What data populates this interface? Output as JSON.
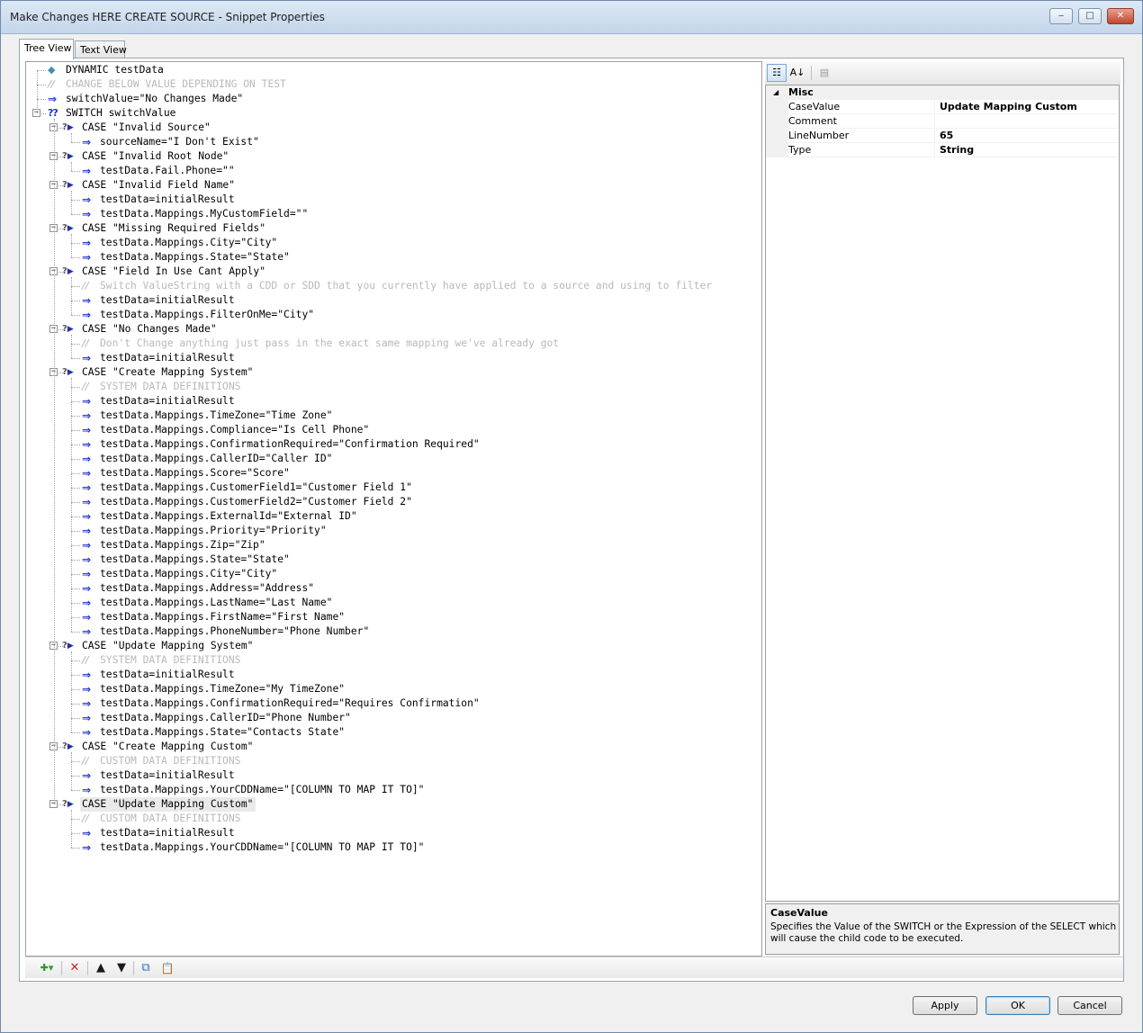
{
  "window": {
    "title": "Make Changes HERE CREATE SOURCE - Snippet Properties",
    "controls": {
      "minimize": "‒",
      "maximize": "□",
      "close": "✕"
    }
  },
  "tabs": [
    "Tree View",
    "Text View"
  ],
  "tree": [
    {
      "kind": "dynamic",
      "text": "DYNAMIC testData",
      "indent": 0
    },
    {
      "kind": "comment",
      "text": "CHANGE BELOW VALUE DEPENDING ON TEST",
      "indent": 0
    },
    {
      "kind": "assign",
      "text": "switchValue=\"No Changes Made\"",
      "indent": 0
    },
    {
      "kind": "switch",
      "text": "SWITCH switchValue",
      "indent": 0
    },
    {
      "kind": "case",
      "text": "CASE \"Invalid Source\"",
      "indent": 1
    },
    {
      "kind": "assign",
      "text": "sourceName=\"I Don't Exist\"",
      "indent": 2
    },
    {
      "kind": "case",
      "text": "CASE \"Invalid Root Node\"",
      "indent": 1
    },
    {
      "kind": "assign",
      "text": "testData.Fail.Phone=\"\"",
      "indent": 2
    },
    {
      "kind": "case",
      "text": "CASE \"Invalid Field Name\"",
      "indent": 1
    },
    {
      "kind": "assign",
      "text": "testData=initialResult",
      "indent": 2
    },
    {
      "kind": "assign",
      "text": "testData.Mappings.MyCustomField=\"\"",
      "indent": 2
    },
    {
      "kind": "case",
      "text": "CASE \"Missing Required Fields\"",
      "indent": 1
    },
    {
      "kind": "assign",
      "text": "testData.Mappings.City=\"City\"",
      "indent": 2
    },
    {
      "kind": "assign",
      "text": "testData.Mappings.State=\"State\"",
      "indent": 2
    },
    {
      "kind": "case",
      "text": "CASE \"Field In Use Cant Apply\"",
      "indent": 1
    },
    {
      "kind": "comment",
      "text": "Switch ValueString with a CDD or SDD that you currently have applied to a source and using to filter",
      "indent": 2
    },
    {
      "kind": "assign",
      "text": "testData=initialResult",
      "indent": 2
    },
    {
      "kind": "assign",
      "text": "testData.Mappings.FilterOnMe=\"City\"",
      "indent": 2
    },
    {
      "kind": "case",
      "text": "CASE \"No Changes Made\"",
      "indent": 1
    },
    {
      "kind": "comment",
      "text": "Don't Change anything just pass in the exact same mapping we've already got",
      "indent": 2
    },
    {
      "kind": "assign",
      "text": "testData=initialResult",
      "indent": 2
    },
    {
      "kind": "case",
      "text": "CASE \"Create Mapping System\"",
      "indent": 1
    },
    {
      "kind": "comment",
      "text": "SYSTEM DATA DEFINITIONS",
      "indent": 2
    },
    {
      "kind": "assign",
      "text": "testData=initialResult",
      "indent": 2
    },
    {
      "kind": "assign",
      "text": "testData.Mappings.TimeZone=\"Time Zone\"",
      "indent": 2
    },
    {
      "kind": "assign",
      "text": "testData.Mappings.Compliance=\"Is Cell Phone\"",
      "indent": 2
    },
    {
      "kind": "assign",
      "text": "testData.Mappings.ConfirmationRequired=\"Confirmation Required\"",
      "indent": 2
    },
    {
      "kind": "assign",
      "text": "testData.Mappings.CallerID=\"Caller ID\"",
      "indent": 2
    },
    {
      "kind": "assign",
      "text": "testData.Mappings.Score=\"Score\"",
      "indent": 2
    },
    {
      "kind": "assign",
      "text": "testData.Mappings.CustomerField1=\"Customer Field 1\"",
      "indent": 2
    },
    {
      "kind": "assign",
      "text": "testData.Mappings.CustomerField2=\"Customer Field 2\"",
      "indent": 2
    },
    {
      "kind": "assign",
      "text": "testData.Mappings.ExternalId=\"External ID\"",
      "indent": 2
    },
    {
      "kind": "assign",
      "text": "testData.Mappings.Priority=\"Priority\"",
      "indent": 2
    },
    {
      "kind": "assign",
      "text": "testData.Mappings.Zip=\"Zip\"",
      "indent": 2
    },
    {
      "kind": "assign",
      "text": "testData.Mappings.State=\"State\"",
      "indent": 2
    },
    {
      "kind": "assign",
      "text": "testData.Mappings.City=\"City\"",
      "indent": 2
    },
    {
      "kind": "assign",
      "text": "testData.Mappings.Address=\"Address\"",
      "indent": 2
    },
    {
      "kind": "assign",
      "text": "testData.Mappings.LastName=\"Last Name\"",
      "indent": 2
    },
    {
      "kind": "assign",
      "text": "testData.Mappings.FirstName=\"First Name\"",
      "indent": 2
    },
    {
      "kind": "assign",
      "text": "testData.Mappings.PhoneNumber=\"Phone Number\"",
      "indent": 2
    },
    {
      "kind": "case",
      "text": "CASE \"Update Mapping System\"",
      "indent": 1
    },
    {
      "kind": "comment",
      "text": "SYSTEM DATA DEFINITIONS",
      "indent": 2
    },
    {
      "kind": "assign",
      "text": "testData=initialResult",
      "indent": 2
    },
    {
      "kind": "assign",
      "text": "testData.Mappings.TimeZone=\"My TimeZone\"",
      "indent": 2
    },
    {
      "kind": "assign",
      "text": "testData.Mappings.ConfirmationRequired=\"Requires Confirmation\"",
      "indent": 2
    },
    {
      "kind": "assign",
      "text": "testData.Mappings.CallerID=\"Phone Number\"",
      "indent": 2
    },
    {
      "kind": "assign",
      "text": "testData.Mappings.State=\"Contacts State\"",
      "indent": 2
    },
    {
      "kind": "case",
      "text": "CASE \"Create Mapping Custom\"",
      "indent": 1
    },
    {
      "kind": "comment",
      "text": "CUSTOM DATA DEFINITIONS",
      "indent": 2
    },
    {
      "kind": "assign",
      "text": "testData=initialResult",
      "indent": 2
    },
    {
      "kind": "assign",
      "text": "testData.Mappings.YourCDDName=\"[COLUMN TO MAP IT TO]\"",
      "indent": 2
    },
    {
      "kind": "case",
      "text": "CASE \"Update Mapping Custom\"",
      "indent": 1,
      "selected": true
    },
    {
      "kind": "comment",
      "text": "CUSTOM DATA DEFINITIONS",
      "indent": 2
    },
    {
      "kind": "assign",
      "text": "testData=initialResult",
      "indent": 2
    },
    {
      "kind": "assign",
      "text": "testData.Mappings.YourCDDName=\"[COLUMN TO MAP IT TO]\"",
      "indent": 2
    }
  ],
  "tree_toolbar": [
    {
      "name": "add-node-icon",
      "glyph": "✚▾",
      "color": "#2a9b2a"
    },
    {
      "name": "delete-node-icon",
      "glyph": "✕",
      "color": "#d21d1d"
    },
    {
      "name": "move-up-icon",
      "glyph": "▲",
      "color": "#1a1a1a"
    },
    {
      "name": "move-down-icon",
      "glyph": "▼",
      "color": "#1a1a1a"
    },
    {
      "name": "copy-icon",
      "glyph": "⧉",
      "color": "#2f6fc0"
    },
    {
      "name": "paste-icon",
      "glyph": "📋",
      "color": "#b07a2a"
    }
  ],
  "properties": {
    "toolbar": {
      "categorized": "☷",
      "alphabetical": "A↓",
      "pages": "▤"
    },
    "category": "Misc",
    "rows": [
      {
        "name": "CaseValue",
        "value": "Update Mapping Custom"
      },
      {
        "name": "Comment",
        "value": ""
      },
      {
        "name": "LineNumber",
        "value": "65"
      },
      {
        "name": "Type",
        "value": "String"
      }
    ],
    "description": {
      "title": "CaseValue",
      "text": "Specifies the Value of the SWITCH or the Expression of the SELECT which will cause the child code to be executed."
    }
  },
  "buttons": {
    "apply": "Apply",
    "ok": "OK",
    "cancel": "Cancel"
  },
  "colors": {
    "assign_arrow": "#1f2fd0",
    "comment_text": "#b9b9b9",
    "window_border": "#6f8aa8"
  }
}
